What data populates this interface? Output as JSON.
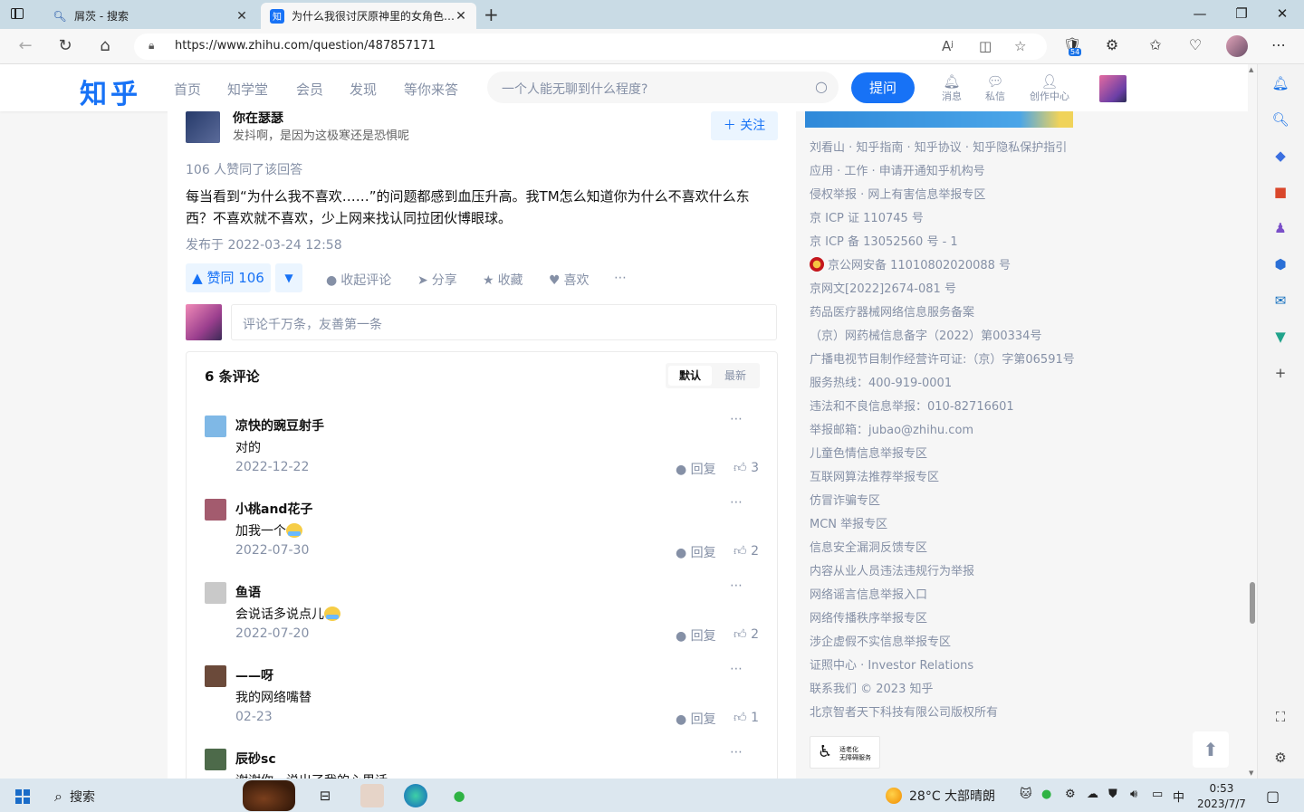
{
  "browser": {
    "tabs": [
      {
        "label": "屑茨 - 搜索",
        "icon": "search-icon",
        "active": false
      },
      {
        "label": "为什么我很讨厌原神里的女角色…",
        "icon": "zhihu-favicon",
        "favicon_text": "知",
        "active": true
      }
    ],
    "url": "https://www.zhihu.com/question/487857171",
    "extension_badge": "54"
  },
  "header": {
    "logo": "知乎",
    "nav": [
      "首页",
      "知学堂",
      "会员",
      "发现",
      "等你来答"
    ],
    "search_placeholder": "一个人能无聊到什么程度?",
    "ask_label": "提问",
    "icons": [
      {
        "name": "notifications",
        "label": "消息"
      },
      {
        "name": "messages",
        "label": "私信"
      },
      {
        "name": "creator-center",
        "label": "创作中心"
      }
    ]
  },
  "answer": {
    "author_name": "你在瑟瑟",
    "author_bio": "发抖啊，是因为这极寒还是恐惧呢",
    "follow_label": "关注",
    "voters": "106 人赞同了该回答",
    "content": "每当看到“为什么我不喜欢……”的问题都感到血压升高。我TM怎么知道你为什么不喜欢什么东西？不喜欢就不喜欢，少上网来找认同拉团伙博眼球。",
    "published": "发布于 2022-03-24 12:58",
    "vote_label": "▲ 赞同 106",
    "actions": [
      "收起评论",
      "分享",
      "收藏",
      "喜欢"
    ],
    "comment_placeholder": "评论千万条，友善第一条"
  },
  "comments": {
    "count_label": "6 条评论",
    "sort_default": "默认",
    "sort_latest": "最新",
    "reply_label": "回复",
    "items": [
      {
        "name": "凉快的豌豆射手",
        "text": "对的",
        "date": "2022-12-22",
        "likes": "3",
        "emoji": false,
        "avatar_color": "#7fb8e6"
      },
      {
        "name": "小桃and花子",
        "text": "加我一个",
        "date": "2022-07-30",
        "likes": "2",
        "emoji": true,
        "avatar_color": "#a35b6e"
      },
      {
        "name": "鱼语",
        "text": "会说话多说点儿",
        "date": "2022-07-20",
        "likes": "2",
        "emoji": true,
        "avatar_color": "#c9c9c9"
      },
      {
        "name": "——呀",
        "text": "我的网络嘴替",
        "date": "02-23",
        "likes": "1",
        "emoji": false,
        "avatar_color": "#6b4a3a"
      },
      {
        "name": "辰砂sc",
        "text": "谢谢你，说出了我的心里话",
        "date": "",
        "likes": "",
        "emoji": false,
        "avatar_color": "#4d6a4a"
      }
    ]
  },
  "sidebar": {
    "links": [
      "刘看山 · 知乎指南 · 知乎协议 · 知乎隐私保护指引",
      "应用 · 工作 · 申请开通知乎机构号",
      "侵权举报 · 网上有害信息举报专区",
      "京 ICP 证 110745 号",
      "京 ICP 备 13052560 号 - 1",
      "京公网安备 11010802020088 号",
      "京网文[2022]2674-081 号",
      "药品医疗器械网络信息服务备案",
      "（京）网药械信息备字（2022）第00334号",
      "广播电视节目制作经营许可证:（京）字第06591号",
      "服务热线：400-919-0001",
      "违法和不良信息举报：010-82716601",
      "举报邮箱：jubao@zhihu.com",
      "儿童色情信息举报专区",
      "互联网算法推荐举报专区",
      "仿冒诈骗专区",
      "MCN 举报专区",
      "信息安全漏洞反馈专区",
      "内容从业人员违法违规行为举报",
      "网络谣言信息举报入口",
      "网络传播秩序举报专区",
      "涉企虚假不实信息举报专区",
      "证照中心 · Investor Relations",
      "联系我们 © 2023 知乎",
      "北京智者天下科技有限公司版权所有"
    ],
    "accessibility_line1": "适老化",
    "accessibility_line2": "无障碍服务"
  },
  "taskbar": {
    "search_label": "搜索",
    "weather": "28°C  大部晴朗",
    "ime": "中",
    "time": "0:53",
    "date": "2023/7/7"
  }
}
